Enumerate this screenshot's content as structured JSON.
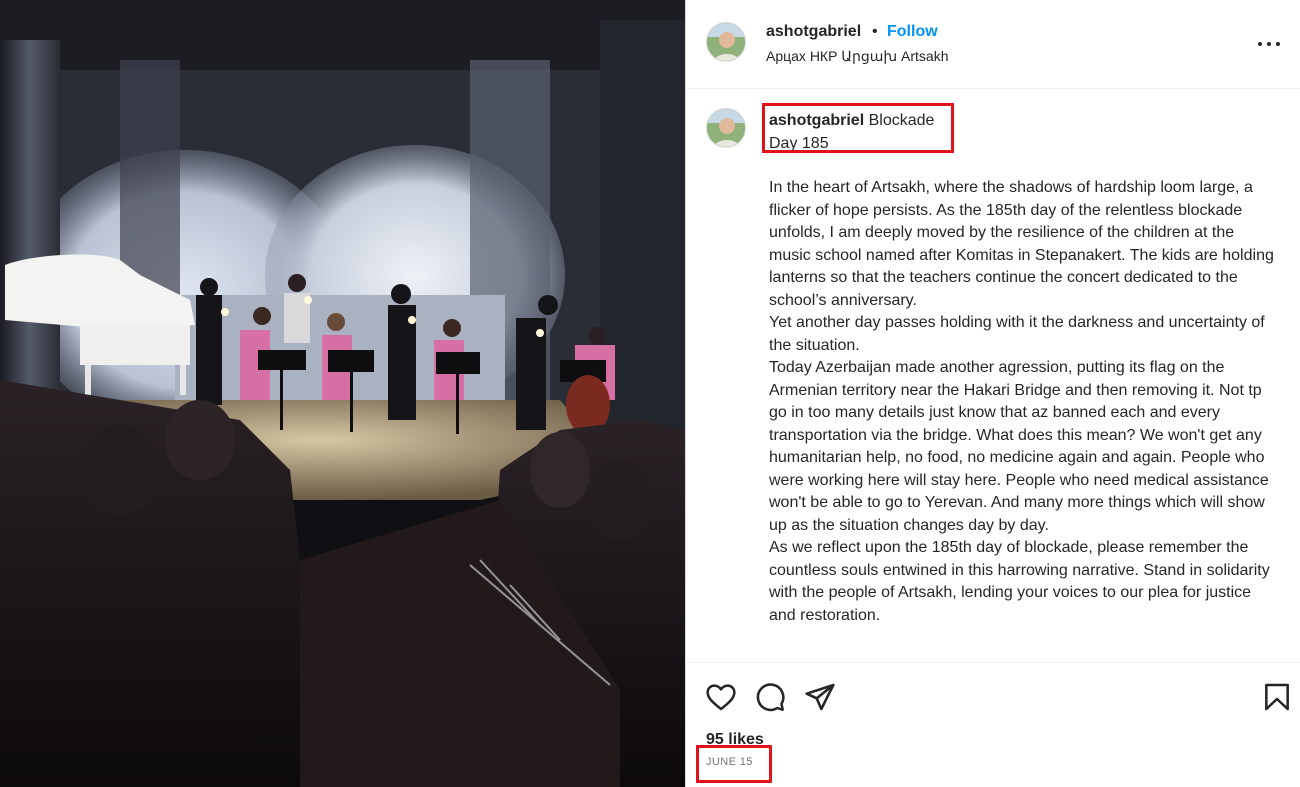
{
  "post": {
    "username": "ashotgabriel",
    "separator": "•",
    "follow_label": "Follow",
    "location": "Арцах НКР Արցախ Artsakh",
    "caption_title_line1": "Blockade",
    "caption_title_line2": "Day 185",
    "caption_paragraphs": [
      "In the heart of Artsakh, where the shadows of hardship loom large, a flicker of hope persists. As the 185th day of the relentless blockade unfolds, I am deeply moved by the resilience of the children at the music school named after Komitas in Stepanakert. The kids are holding lanterns so that the teachers continue the concert dedicated to the school’s anniversary.",
      "Yet another day passes holding with it the darkness and uncertainty of the situation.",
      "Today Azerbaijan made another agression, putting its flag on the Armenian territory near the Hakari Bridge and then removing it. Not tp go in too many details just know that az banned each and every transportation via the bridge. What does this mean? We won't get any humanitarian help, no food, no medicine again and again. People who were working here will stay here. People who need medical assistance won't be able to go to Yerevan. And many more things which will show up as the situation changes day by day.",
      "As we reflect upon the 185th day of blockade, please remember the countless souls entwined in this harrowing narrative. Stand in solidarity with the people of Artsakh, lending your voices to our plea for justice and restoration."
    ],
    "likes": "95 likes",
    "date": "JUNE 15"
  },
  "icons": {
    "like": "heart-icon",
    "comment": "comment-icon",
    "share": "send-icon",
    "save": "bookmark-icon",
    "more": "more-options-icon"
  },
  "colors": {
    "follow": "#0095f6",
    "highlight": "#e0121a",
    "text": "#262626",
    "muted": "#737373"
  }
}
